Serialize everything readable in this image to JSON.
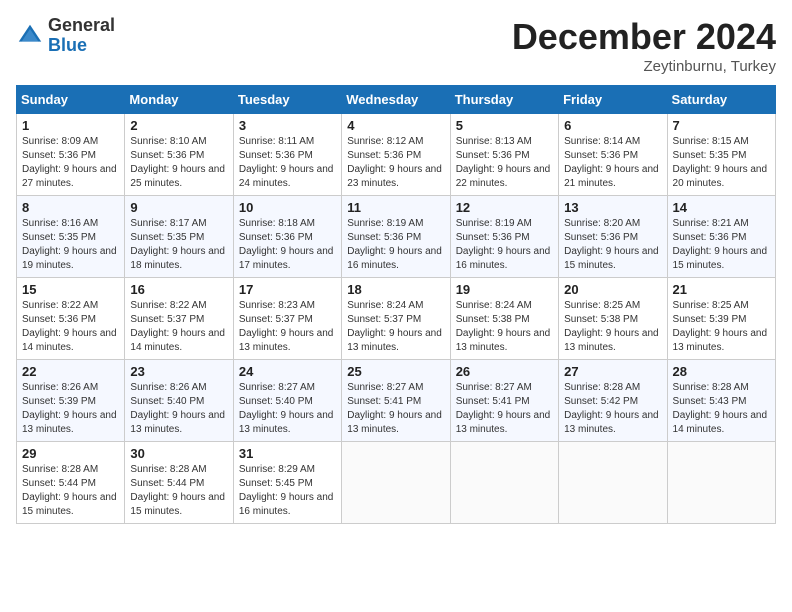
{
  "header": {
    "logo_general": "General",
    "logo_blue": "Blue",
    "month_title": "December 2024",
    "location": "Zeytinburnu, Turkey"
  },
  "calendar": {
    "days_of_week": [
      "Sunday",
      "Monday",
      "Tuesday",
      "Wednesday",
      "Thursday",
      "Friday",
      "Saturday"
    ],
    "weeks": [
      [
        {
          "day": "1",
          "sunrise": "Sunrise: 8:09 AM",
          "sunset": "Sunset: 5:36 PM",
          "daylight": "Daylight: 9 hours and 27 minutes."
        },
        {
          "day": "2",
          "sunrise": "Sunrise: 8:10 AM",
          "sunset": "Sunset: 5:36 PM",
          "daylight": "Daylight: 9 hours and 25 minutes."
        },
        {
          "day": "3",
          "sunrise": "Sunrise: 8:11 AM",
          "sunset": "Sunset: 5:36 PM",
          "daylight": "Daylight: 9 hours and 24 minutes."
        },
        {
          "day": "4",
          "sunrise": "Sunrise: 8:12 AM",
          "sunset": "Sunset: 5:36 PM",
          "daylight": "Daylight: 9 hours and 23 minutes."
        },
        {
          "day": "5",
          "sunrise": "Sunrise: 8:13 AM",
          "sunset": "Sunset: 5:36 PM",
          "daylight": "Daylight: 9 hours and 22 minutes."
        },
        {
          "day": "6",
          "sunrise": "Sunrise: 8:14 AM",
          "sunset": "Sunset: 5:36 PM",
          "daylight": "Daylight: 9 hours and 21 minutes."
        },
        {
          "day": "7",
          "sunrise": "Sunrise: 8:15 AM",
          "sunset": "Sunset: 5:35 PM",
          "daylight": "Daylight: 9 hours and 20 minutes."
        }
      ],
      [
        {
          "day": "8",
          "sunrise": "Sunrise: 8:16 AM",
          "sunset": "Sunset: 5:35 PM",
          "daylight": "Daylight: 9 hours and 19 minutes."
        },
        {
          "day": "9",
          "sunrise": "Sunrise: 8:17 AM",
          "sunset": "Sunset: 5:35 PM",
          "daylight": "Daylight: 9 hours and 18 minutes."
        },
        {
          "day": "10",
          "sunrise": "Sunrise: 8:18 AM",
          "sunset": "Sunset: 5:36 PM",
          "daylight": "Daylight: 9 hours and 17 minutes."
        },
        {
          "day": "11",
          "sunrise": "Sunrise: 8:19 AM",
          "sunset": "Sunset: 5:36 PM",
          "daylight": "Daylight: 9 hours and 16 minutes."
        },
        {
          "day": "12",
          "sunrise": "Sunrise: 8:19 AM",
          "sunset": "Sunset: 5:36 PM",
          "daylight": "Daylight: 9 hours and 16 minutes."
        },
        {
          "day": "13",
          "sunrise": "Sunrise: 8:20 AM",
          "sunset": "Sunset: 5:36 PM",
          "daylight": "Daylight: 9 hours and 15 minutes."
        },
        {
          "day": "14",
          "sunrise": "Sunrise: 8:21 AM",
          "sunset": "Sunset: 5:36 PM",
          "daylight": "Daylight: 9 hours and 15 minutes."
        }
      ],
      [
        {
          "day": "15",
          "sunrise": "Sunrise: 8:22 AM",
          "sunset": "Sunset: 5:36 PM",
          "daylight": "Daylight: 9 hours and 14 minutes."
        },
        {
          "day": "16",
          "sunrise": "Sunrise: 8:22 AM",
          "sunset": "Sunset: 5:37 PM",
          "daylight": "Daylight: 9 hours and 14 minutes."
        },
        {
          "day": "17",
          "sunrise": "Sunrise: 8:23 AM",
          "sunset": "Sunset: 5:37 PM",
          "daylight": "Daylight: 9 hours and 13 minutes."
        },
        {
          "day": "18",
          "sunrise": "Sunrise: 8:24 AM",
          "sunset": "Sunset: 5:37 PM",
          "daylight": "Daylight: 9 hours and 13 minutes."
        },
        {
          "day": "19",
          "sunrise": "Sunrise: 8:24 AM",
          "sunset": "Sunset: 5:38 PM",
          "daylight": "Daylight: 9 hours and 13 minutes."
        },
        {
          "day": "20",
          "sunrise": "Sunrise: 8:25 AM",
          "sunset": "Sunset: 5:38 PM",
          "daylight": "Daylight: 9 hours and 13 minutes."
        },
        {
          "day": "21",
          "sunrise": "Sunrise: 8:25 AM",
          "sunset": "Sunset: 5:39 PM",
          "daylight": "Daylight: 9 hours and 13 minutes."
        }
      ],
      [
        {
          "day": "22",
          "sunrise": "Sunrise: 8:26 AM",
          "sunset": "Sunset: 5:39 PM",
          "daylight": "Daylight: 9 hours and 13 minutes."
        },
        {
          "day": "23",
          "sunrise": "Sunrise: 8:26 AM",
          "sunset": "Sunset: 5:40 PM",
          "daylight": "Daylight: 9 hours and 13 minutes."
        },
        {
          "day": "24",
          "sunrise": "Sunrise: 8:27 AM",
          "sunset": "Sunset: 5:40 PM",
          "daylight": "Daylight: 9 hours and 13 minutes."
        },
        {
          "day": "25",
          "sunrise": "Sunrise: 8:27 AM",
          "sunset": "Sunset: 5:41 PM",
          "daylight": "Daylight: 9 hours and 13 minutes."
        },
        {
          "day": "26",
          "sunrise": "Sunrise: 8:27 AM",
          "sunset": "Sunset: 5:41 PM",
          "daylight": "Daylight: 9 hours and 13 minutes."
        },
        {
          "day": "27",
          "sunrise": "Sunrise: 8:28 AM",
          "sunset": "Sunset: 5:42 PM",
          "daylight": "Daylight: 9 hours and 13 minutes."
        },
        {
          "day": "28",
          "sunrise": "Sunrise: 8:28 AM",
          "sunset": "Sunset: 5:43 PM",
          "daylight": "Daylight: 9 hours and 14 minutes."
        }
      ],
      [
        {
          "day": "29",
          "sunrise": "Sunrise: 8:28 AM",
          "sunset": "Sunset: 5:44 PM",
          "daylight": "Daylight: 9 hours and 15 minutes."
        },
        {
          "day": "30",
          "sunrise": "Sunrise: 8:28 AM",
          "sunset": "Sunset: 5:44 PM",
          "daylight": "Daylight: 9 hours and 15 minutes."
        },
        {
          "day": "31",
          "sunrise": "Sunrise: 8:29 AM",
          "sunset": "Sunset: 5:45 PM",
          "daylight": "Daylight: 9 hours and 16 minutes."
        },
        null,
        null,
        null,
        null
      ]
    ]
  }
}
